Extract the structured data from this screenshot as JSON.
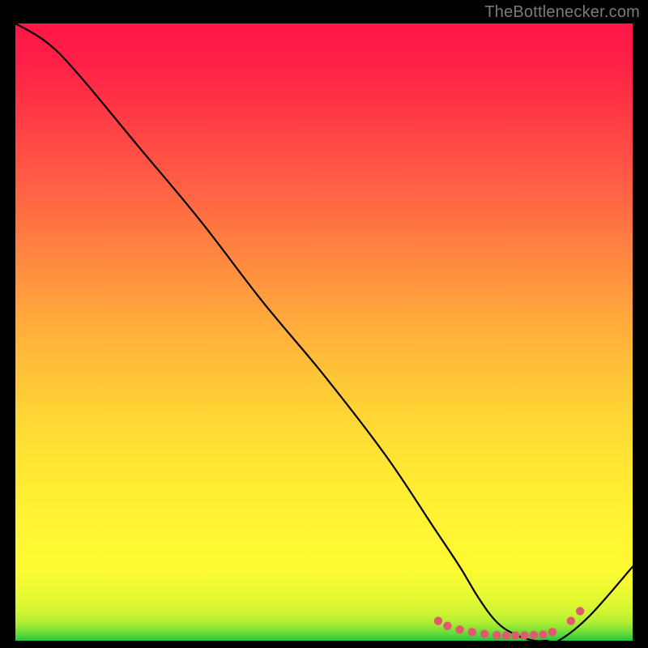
{
  "attribution": "TheBottlenecker.com",
  "chart_data": {
    "type": "line",
    "title": "",
    "xlabel": "",
    "ylabel": "",
    "xlim": [
      0,
      100
    ],
    "ylim": [
      0,
      100
    ],
    "series": [
      {
        "name": "bottleneck-curve",
        "x": [
          0,
          5,
          10,
          20,
          30,
          40,
          50,
          60,
          68,
          72,
          75,
          78,
          81,
          84,
          86,
          88,
          93,
          100
        ],
        "y": [
          100,
          97,
          92,
          80,
          68,
          55,
          43,
          30,
          18,
          12,
          7,
          3,
          1,
          0,
          0,
          0,
          4,
          12
        ]
      },
      {
        "name": "markers",
        "x": [
          68.5,
          70,
          72,
          74,
          76,
          78,
          79.5,
          81,
          82.5,
          84,
          85.5,
          87,
          90,
          91.5
        ],
        "y": [
          3.2,
          2.4,
          1.8,
          1.4,
          1.1,
          0.9,
          0.85,
          0.85,
          0.85,
          0.9,
          1.0,
          1.4,
          3.2,
          4.8
        ]
      }
    ],
    "gradient_bands": [
      "#ff1747",
      "#ff953f",
      "#ffe733",
      "#1ec83f"
    ],
    "marker_color": "#e05a6e",
    "curve_color": "#000000"
  }
}
